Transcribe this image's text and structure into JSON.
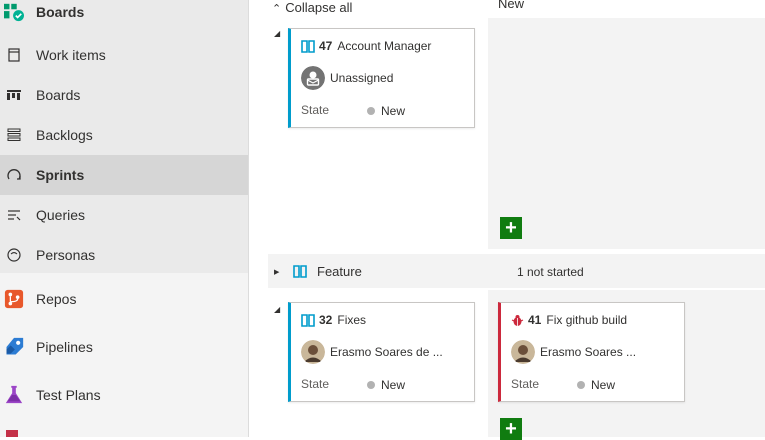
{
  "sidebar": {
    "items": [
      {
        "label": "Boards",
        "icon": "boards-hub-icon"
      },
      {
        "label": "Work items",
        "icon": "work-items-icon"
      },
      {
        "label": "Boards",
        "icon": "boards-icon"
      },
      {
        "label": "Backlogs",
        "icon": "backlogs-icon"
      },
      {
        "label": "Sprints",
        "icon": "sprints-icon"
      },
      {
        "label": "Queries",
        "icon": "queries-icon"
      },
      {
        "label": "Personas",
        "icon": "personas-icon"
      },
      {
        "label": "Repos",
        "icon": "repos-icon"
      },
      {
        "label": "Pipelines",
        "icon": "pipelines-icon"
      },
      {
        "label": "Test Plans",
        "icon": "test-plans-icon"
      }
    ]
  },
  "board": {
    "collapse_label": "Collapse all",
    "column_header": "New",
    "feature_row": {
      "label": "Feature",
      "status": "1 not started"
    },
    "cards": [
      {
        "id": "47",
        "title": "Account Manager",
        "assignee": "Unassigned",
        "state_label": "State",
        "state": "New",
        "type": "backlog"
      },
      {
        "id": "32",
        "title": "Fixes",
        "assignee": "Erasmo Soares de ...",
        "state_label": "State",
        "state": "New",
        "type": "backlog"
      },
      {
        "id": "41",
        "title": "Fix github build",
        "assignee": "Erasmo Soares ...",
        "state_label": "State",
        "state": "New",
        "type": "bug"
      }
    ],
    "add_label": "+"
  },
  "colors": {
    "accent_blue": "#009ccc",
    "bug_red": "#cc293d",
    "add_green": "#107c10"
  }
}
